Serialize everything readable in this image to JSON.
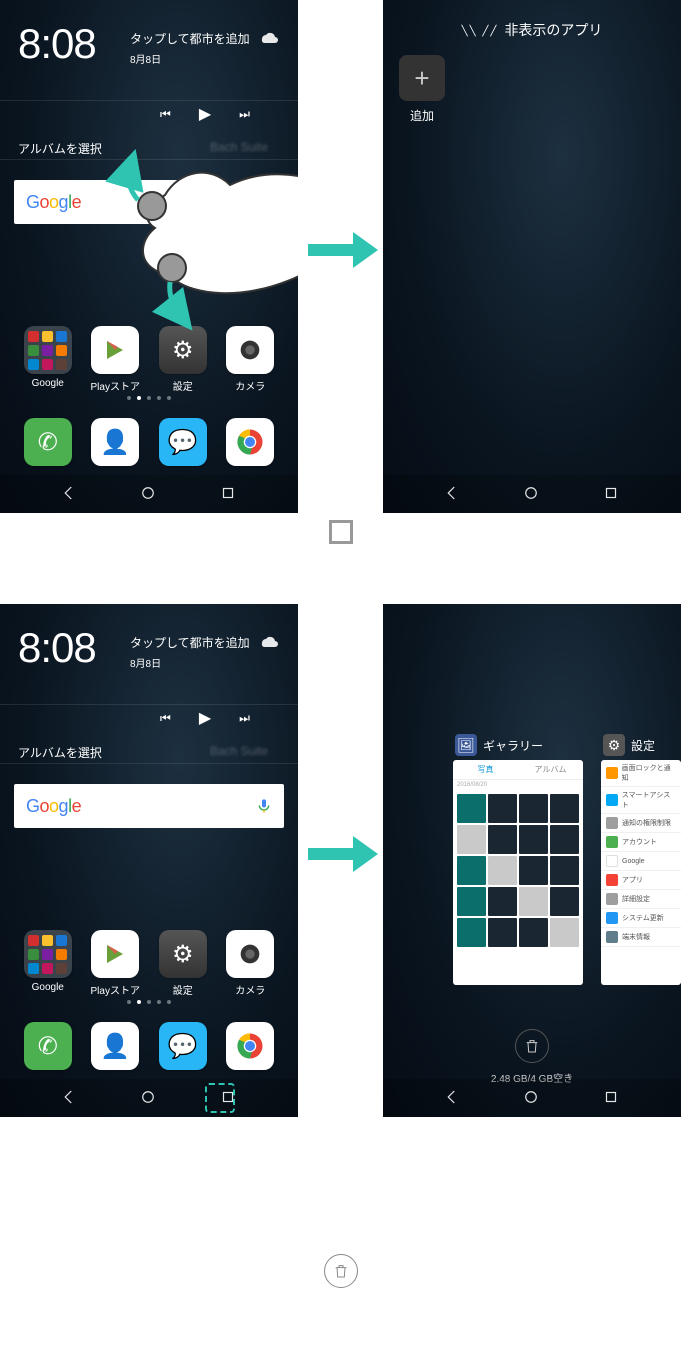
{
  "home": {
    "clock": "8:08",
    "weather_tap": "タップして都市を追加",
    "date": "8月8日",
    "album_label": "アルバムを選択",
    "search_brand": "Google",
    "apps": {
      "google": "Google",
      "playstore": "Playストア",
      "settings": "設定",
      "camera": "カメラ"
    }
  },
  "hidden": {
    "title": "非表示のアプリ",
    "add": "追加"
  },
  "recents": {
    "card1_title": "ギャラリー",
    "card1_tab1": "写真",
    "card1_tab2": "アルバム",
    "card1_date": "2016/08/20",
    "card2_title": "設定",
    "settings_items": {
      "r1": "画面ロックと通知",
      "r2": "スマートアシスト",
      "r3": "通知の権限制限",
      "r4": "アカウント",
      "r5": "Google",
      "r6": "アプリ",
      "r7": "詳細設定",
      "r8": "システム更新",
      "r9": "端末情報"
    },
    "storage": "2.48 GB/4 GB空き"
  }
}
